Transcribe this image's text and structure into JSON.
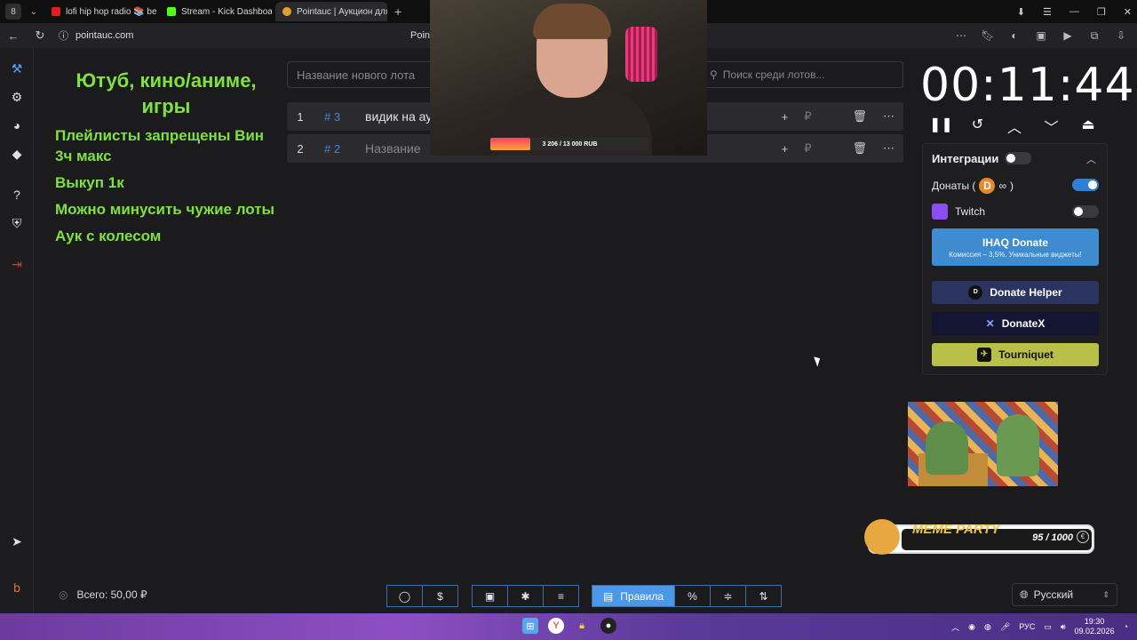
{
  "browser": {
    "tabs": [
      {
        "label": "lofi hip hop radio 📚 beats",
        "color": "#e02020"
      },
      {
        "label": "Stream - Kick Dashboard",
        "color": "#53fc18"
      },
      {
        "label": "Pointauc | Аукцион для",
        "color": "#e0a030"
      }
    ],
    "url": "pointauc.com",
    "page_title": "Point"
  },
  "rules": {
    "heading": "Ютуб, кино/аниме, игры",
    "lines": [
      "Плейлисты запрещены Вин 3ч макс",
      "Выкуп 1к",
      "Можно минусить чужие лоты",
      "Аук с колесом"
    ]
  },
  "lot_input": {
    "placeholder": "Название нового лота"
  },
  "lot_search": {
    "placeholder": "Поиск среди лотов..."
  },
  "lots": [
    {
      "num": "1",
      "id": "# 3",
      "name": "видик на ау",
      "currency": "₽"
    },
    {
      "num": "2",
      "id": "# 2",
      "name": "Название",
      "currency": "₽"
    }
  ],
  "webcam": {
    "goal": "3 206 / 13 000 RUB",
    "goal_fraction": 0.25
  },
  "timer": {
    "value": "00:11:44"
  },
  "integrations": {
    "title": "Интеграции",
    "donations_label": "Донаты (",
    "donations_suffix": ")",
    "twitch_label": "Twitch",
    "ihaq": {
      "label": "IHAQ Donate",
      "sub": "Комиссия – 3,5%. Уникальные виджеты!"
    },
    "donate_helper": "Donate Helper",
    "donatex": "DonateX",
    "tourniquet": "Tourniquet"
  },
  "meme_party": {
    "title": "MEME PARTY",
    "count": "95 / 1000"
  },
  "footer": {
    "total": "Всего: 50,00 ₽",
    "rules_button": "Правила",
    "language": "Русский"
  },
  "taskbar": {
    "lang": "РУС",
    "time": "19:30",
    "date": "09.02.2026"
  }
}
